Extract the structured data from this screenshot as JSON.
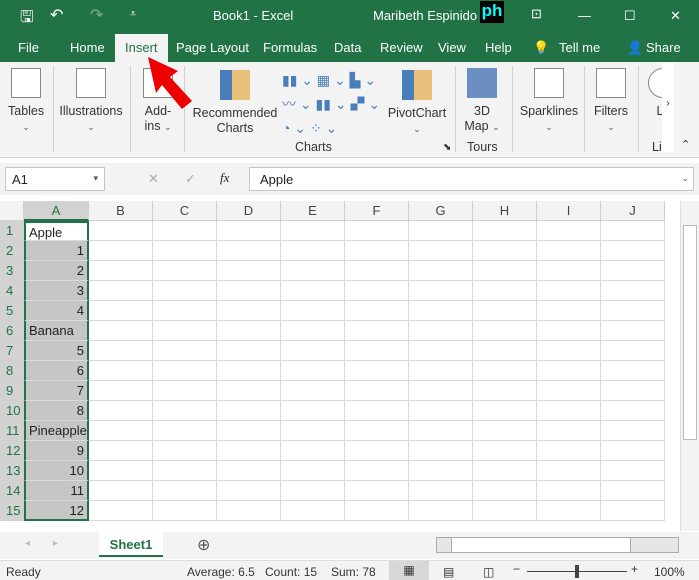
{
  "title": {
    "doc": "Book1  -  Excel",
    "user": "Maribeth Espinido",
    "logo": "ph"
  },
  "tabs": [
    "File",
    "Home",
    "Insert",
    "Page Layout",
    "Formulas",
    "Data",
    "Review",
    "View",
    "Help",
    "Tell me",
    "Share"
  ],
  "active_tab": "Insert",
  "ribbon": {
    "tables": "Tables",
    "illustrations": "Illustrations",
    "addins1": "Add-",
    "addins2": "ins",
    "rec1": "Recommended",
    "rec2": "Charts",
    "charts_group": "Charts",
    "pivotchart": "PivotChart",
    "map1": "3D",
    "map2": "Map",
    "tours": "Tours",
    "sparklines": "Sparklines",
    "filters": "Filters",
    "links": "L",
    "links_group": "Li"
  },
  "formula": {
    "namebox": "A1",
    "cancel": "✕",
    "enter": "✓",
    "fx": "fx",
    "value": "Apple"
  },
  "columns": [
    "A",
    "B",
    "C",
    "D",
    "E",
    "F",
    "G",
    "H",
    "I",
    "J"
  ],
  "rows": [
    "Apple",
    "1",
    "2",
    "3",
    "4",
    "Banana",
    "5",
    "6",
    "7",
    "8",
    "Pineapple",
    "9",
    "10",
    "11",
    "12"
  ],
  "sheet": {
    "name": "Sheet1"
  },
  "status": {
    "ready": "Ready",
    "average": "Average: 6.5",
    "count": "Count: 15",
    "sum": "Sum: 78",
    "zoom": "100%"
  },
  "colors": {
    "accent": "#217346",
    "selection": "#c6c6c6"
  }
}
